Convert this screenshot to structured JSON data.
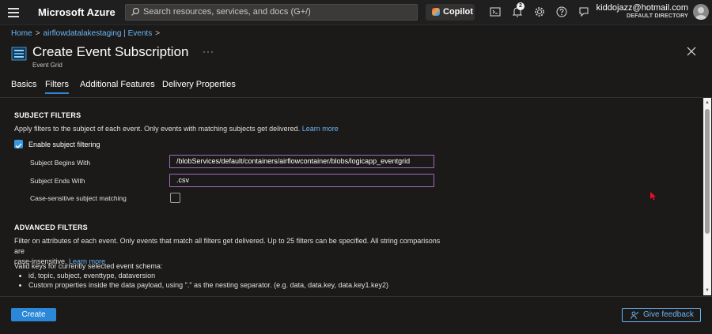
{
  "topbar": {
    "brand": "Microsoft Azure",
    "search_placeholder": "Search resources, services, and docs (G+/)",
    "copilot_label": "Copilot",
    "notification_count": "2",
    "account_email": "kiddojazz@hotmail.com",
    "account_directory": "DEFAULT DIRECTORY",
    "icons": [
      "hamburger-icon",
      "search-icon",
      "copilot-icon",
      "terminal-icon",
      "bell-icon",
      "gear-icon",
      "help-icon",
      "feedback-icon",
      "avatar"
    ]
  },
  "breadcrumb": {
    "items": [
      "Home",
      "airflowdatalakestaging | Events"
    ]
  },
  "header": {
    "title": "Create Event Subscription",
    "subtitle": "Event Grid",
    "more": "···"
  },
  "tabs": [
    {
      "label": "Basics",
      "active": false
    },
    {
      "label": "Filters",
      "active": true
    },
    {
      "label": "Additional Features",
      "active": false
    },
    {
      "label": "Delivery Properties",
      "active": false
    }
  ],
  "subject_filters": {
    "title": "SUBJECT FILTERS",
    "description": "Apply filters to the subject of each event. Only events with matching subjects get delivered.",
    "learn_more": "Learn more",
    "enable_label": "Enable subject filtering",
    "enable_checked": true,
    "begins_with_label": "Subject Begins With",
    "begins_with_value": "/blobServices/default/containers/airflowcontainer/blobs/logicapp_eventgrid",
    "ends_with_label": "Subject Ends With",
    "ends_with_value": ".csv",
    "case_sensitive_label": "Case-sensitive subject matching",
    "case_sensitive_checked": false
  },
  "advanced_filters": {
    "title": "ADVANCED FILTERS",
    "description_line1": "Filter on attributes of each event. Only events that match all filters get delivered. Up to 25 filters can be specified. All string comparisons are",
    "description_line2": "case-insensitive.",
    "learn_more": "Learn more",
    "valid_keys_heading": "Valid keys for currently selected event schema:",
    "bullets": [
      "id, topic, subject, eventtype, dataversion",
      "Custom properties inside the data payload, using \".\" as the nesting separator. (e.g. data, data.key, data.key1.key2)"
    ]
  },
  "footer": {
    "create_label": "Create",
    "feedback_label": "Give feedback"
  },
  "colors": {
    "accent": "#2b88d8",
    "link": "#6cb4f5",
    "input_border": "#a06bc0",
    "background": "#1b1a19"
  }
}
